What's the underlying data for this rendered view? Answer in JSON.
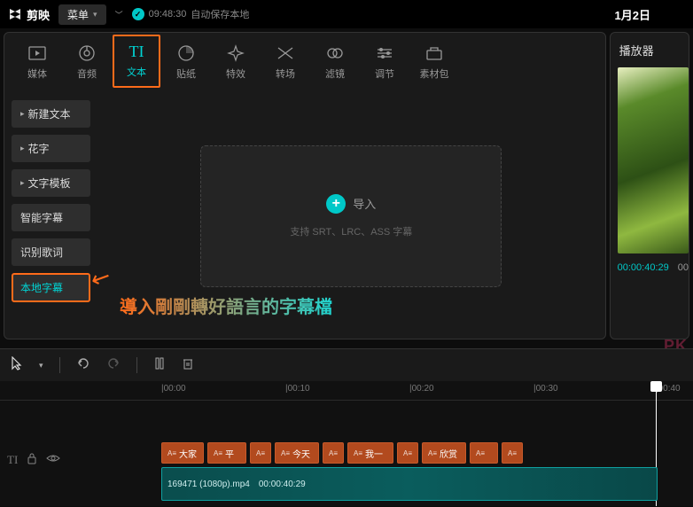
{
  "topbar": {
    "app_name": "剪映",
    "menu_label": "菜单",
    "autosave_time": "09:48:30",
    "autosave_text": "自动保存本地",
    "date": "1月2日"
  },
  "tool_tabs": [
    {
      "icon": "▣",
      "label": "媒体"
    },
    {
      "icon": "◔",
      "label": "音频"
    },
    {
      "icon": "TI",
      "label": "文本"
    },
    {
      "icon": "◑",
      "label": "贴纸"
    },
    {
      "icon": "✦",
      "label": "特效"
    },
    {
      "icon": "⋈",
      "label": "转场"
    },
    {
      "icon": "∞",
      "label": "滤镜"
    },
    {
      "icon": "☰",
      "label": "调节"
    },
    {
      "icon": "▭",
      "label": "素材包"
    }
  ],
  "side_cats": [
    {
      "label": "新建文本",
      "caret": true
    },
    {
      "label": "花字",
      "caret": true
    },
    {
      "label": "文字模板",
      "caret": true
    },
    {
      "label": "智能字幕",
      "caret": false
    },
    {
      "label": "识别歌词",
      "caret": false
    },
    {
      "label": "本地字幕",
      "caret": false
    }
  ],
  "import_box": {
    "btn_label": "导入",
    "hint": "支持 SRT、LRC、ASS 字幕"
  },
  "player": {
    "title": "播放器",
    "current": "00:00:40:29",
    "total": "00"
  },
  "annotation_text": "導入剛剛轉好語言的字幕檔",
  "watermark": "PK",
  "timeline": {
    "ticks": [
      "|00:00",
      "|00:10",
      "|00:20",
      "|00:30",
      "|00:40"
    ],
    "text_clips": [
      "大家",
      "平",
      "",
      "今天",
      "",
      "我一",
      "",
      "欣赏",
      "",
      ""
    ],
    "video_name": "169471 (1080p).mp4",
    "video_duration": "00:00:40:29"
  }
}
